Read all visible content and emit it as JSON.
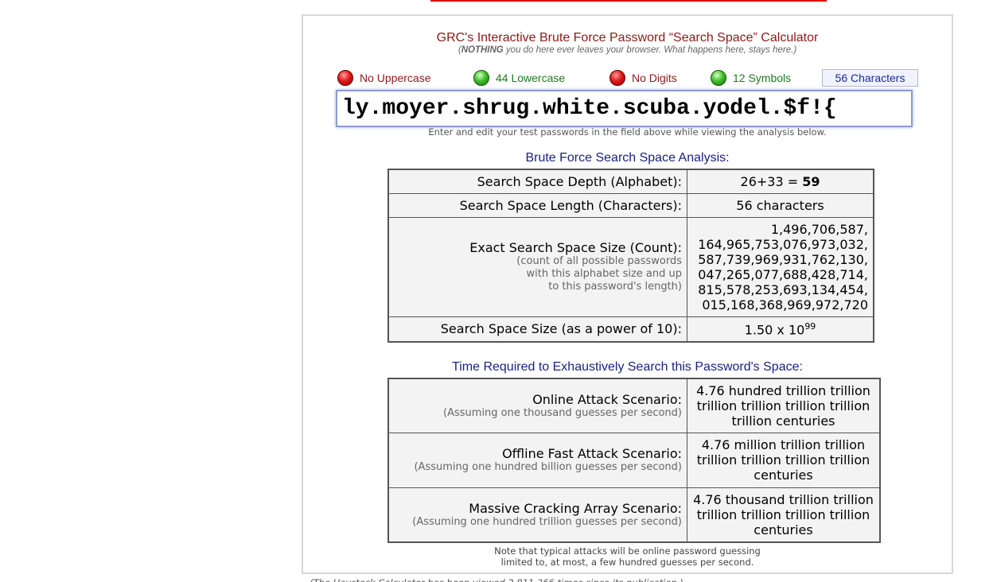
{
  "title": "GRC's Interactive Brute Force Password “Search Space” Calculator",
  "subtitle_bold": "NOTHING",
  "subtitle_rest": "you do here ever leaves your browser. What happens here, stays here.",
  "indicators": [
    {
      "label": "No Uppercase",
      "status": "red"
    },
    {
      "label": "44 Lowercase",
      "status": "green"
    },
    {
      "label": "No Digits",
      "status": "red"
    },
    {
      "label": "12 Symbols",
      "status": "green"
    }
  ],
  "char_count": "56 Characters",
  "password": "ly.moyer.shrug.white.scuba.yodel.$f!{",
  "hint": "Enter and edit your test passwords in the field above while viewing the analysis below.",
  "analysis": {
    "heading": "Brute Force Search Space Analysis:",
    "depth_label": "Search Space Depth (Alphabet):",
    "depth_formula": "26+33 = ",
    "depth_total": "59",
    "length_label": "Search Space Length (Characters):",
    "length_value": "56 characters",
    "count_label": "Exact Search Space Size (Count):",
    "count_note_1": "(count of all possible passwords",
    "count_note_2": "with this alphabet size and up",
    "count_note_3": "to this password's length)",
    "count_lines": [
      "1,496,706,587,",
      "164,965,753,076,973,032,",
      "587,739,969,931,762,130,",
      "047,265,077,688,428,714,",
      "815,578,253,693,134,454,",
      "015,168,368,969,972,720"
    ],
    "power_label": "Search Space Size (as a power of 10):",
    "power_mantissa": "1.50 x 10",
    "power_exponent": "99"
  },
  "time": {
    "heading": "Time Required to Exhaustively Search this Password's Space:",
    "scenarios": [
      {
        "label": "Online Attack Scenario:",
        "note": "(Assuming one thousand guesses per second)",
        "value": "4.76 hundred trillion trillion trillion trillion trillion trillion trillion centuries"
      },
      {
        "label": "Offline Fast Attack Scenario:",
        "note": "(Assuming one hundred billion guesses per second)",
        "value": "4.76 million trillion trillion trillion trillion trillion trillion centuries"
      },
      {
        "label": "Massive Cracking Array Scenario:",
        "note": "(Assuming one hundred trillion guesses per second)",
        "value": "4.76 thousand trillion trillion trillion trillion trillion trillion centuries"
      }
    ]
  },
  "note_1": "Note that typical attacks will be online password guessing",
  "note_2": "limited to, at most, a few hundred guesses per second.",
  "footer": "(The Haystack Calculator has been viewed 2,811,366 times since its publication.)",
  "colors": {
    "title": "#8b1a1a",
    "heading": "#1a237e",
    "indicator_red": "#e01a1a",
    "indicator_green": "#3fc02a"
  }
}
